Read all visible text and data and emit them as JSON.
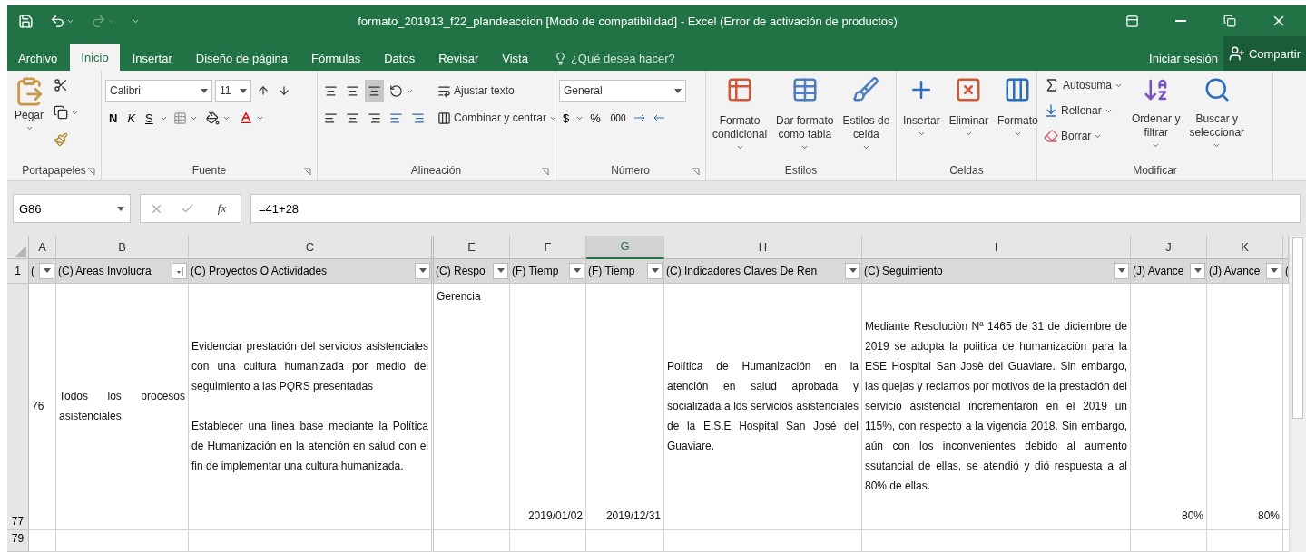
{
  "window": {
    "title": "formato_201913_f22_plandeaccion  [Modo de compatibilidad] - Excel (Error de activación de productos)"
  },
  "ribbon_tabs": [
    {
      "label": "Archivo",
      "selected": false
    },
    {
      "label": "Inicio",
      "selected": true
    },
    {
      "label": "Insertar",
      "selected": false
    },
    {
      "label": "Diseño de página",
      "selected": false
    },
    {
      "label": "Fórmulas",
      "selected": false
    },
    {
      "label": "Datos",
      "selected": false
    },
    {
      "label": "Revisar",
      "selected": false
    },
    {
      "label": "Vista",
      "selected": false
    }
  ],
  "tell_me": {
    "placeholder": "¿Qué desea hacer?"
  },
  "account": {
    "sign_in": "Iniciar sesión",
    "share": "Compartir"
  },
  "ribbon_groups": [
    {
      "kind": "clipboard",
      "label": "Portapapeles",
      "launcher": true,
      "paste": "Pegar"
    },
    {
      "kind": "font",
      "label": "Fuente",
      "launcher": true,
      "font_name": "Calibri",
      "font_size": "11",
      "bold": "N",
      "italic": "K",
      "underline": "S"
    },
    {
      "kind": "alignment",
      "label": "Alineación",
      "launcher": true,
      "vertical_buttons": [
        {
          "selected": false
        },
        {
          "selected": false
        },
        {
          "selected": true
        }
      ],
      "wrap": "Ajustar texto",
      "merge": "Combinar y centrar"
    },
    {
      "kind": "number",
      "label": "Número",
      "launcher": true,
      "format": "General",
      "currency": "$",
      "percent": "%",
      "thousands": "000"
    },
    {
      "kind": "styles",
      "label": "Estilos",
      "launcher": false,
      "buttons": [
        {
          "line1": "Formato",
          "line2": "condicional"
        },
        {
          "line1": "Dar formato",
          "line2": "como tabla"
        },
        {
          "line1": "Estilos de",
          "line2": "celda"
        }
      ]
    },
    {
      "kind": "cells",
      "label": "Celdas",
      "launcher": false,
      "buttons": [
        "Insertar",
        "Eliminar",
        "Formato"
      ]
    },
    {
      "kind": "editing",
      "label": "Modificar",
      "launcher": false,
      "autosum": "Autosuma",
      "fill": "Rellenar",
      "clear": "Borrar",
      "sort": {
        "line1": "Ordenar y",
        "line2": "filtrar"
      },
      "find": {
        "line1": "Buscar y",
        "line2": "seleccionar"
      }
    }
  ],
  "formula_bar": {
    "name_box": "G86",
    "function_label": "fx",
    "formula": "=41+28"
  },
  "sheet": {
    "columns": [
      {
        "letter": "A",
        "selected": false
      },
      {
        "letter": "B",
        "selected": false
      },
      {
        "letter": "C",
        "selected": false
      },
      {
        "letter": "E",
        "selected": false
      },
      {
        "letter": "F",
        "selected": false
      },
      {
        "letter": "G",
        "selected": true
      },
      {
        "letter": "H",
        "selected": false
      },
      {
        "letter": "I",
        "selected": false
      },
      {
        "letter": "J",
        "selected": false
      },
      {
        "letter": "K",
        "selected": false
      },
      {
        "selected": false
      }
    ],
    "header_row": {
      "number": "1",
      "cells": [
        {
          "text": "(",
          "kind": "filter"
        },
        {
          "text": "(C) Areas Involucra",
          "kind": "sorted"
        },
        {
          "text": "(C) Proyectos O Actividades",
          "kind": "filter"
        },
        {
          "text": "(C) Respo",
          "kind": "filter"
        },
        {
          "text": "(F) Tiemp",
          "kind": "filter"
        },
        {
          "text": "(F) Tiemp",
          "kind": "filter"
        },
        {
          "text": "(C) Indicadores Claves De Ren",
          "kind": "filter"
        },
        {
          "text": "(C) Seguimiento",
          "kind": "filter"
        },
        {
          "text": "(J) Avance",
          "kind": "filter"
        },
        {
          "text": "(J) Avance",
          "kind": "filter"
        },
        {
          "text": "(",
          "kind": "partial"
        }
      ]
    },
    "rows": [
      {
        "number": "77",
        "cells": [
          "76",
          "Todos los procesos asistenciales",
          "Evidenciar prestación del servicios asistenciales con una cultura humanizada por medio del seguimiento a las PQRS presentadas\n\nEstablecer una linea base mediante la Política de Humanización en la atención en salud con el fin de implementar una cultura humanizada.",
          "Gerencia",
          "2019/01/02",
          "2019/12/31",
          "Política de Humanización en la atención en salud aprobada y socializada a los servicios asistenciales de la E.S.E Hospital San José del Guaviare.",
          "Mediante Resoluciòn Nª 1465 de 31 de diciembre de 2019 se adopta la politica de humanizaciòn para la ESE Hospital San Josè del Guaviare.  Sin embargo, las quejas y reclamos por motivos de la prestación del servicio asistencial incrementaron en el 2019 un 115%, con respecto a la vigencia 2018. Sin embargo, aún con los inconvenientes debido al aumento ssutancial de ellas, se atendió y dió respuesta a al 80% de ellas.",
          "80%",
          "80%"
        ]
      },
      {
        "number": "79",
        "cells": []
      }
    ]
  }
}
